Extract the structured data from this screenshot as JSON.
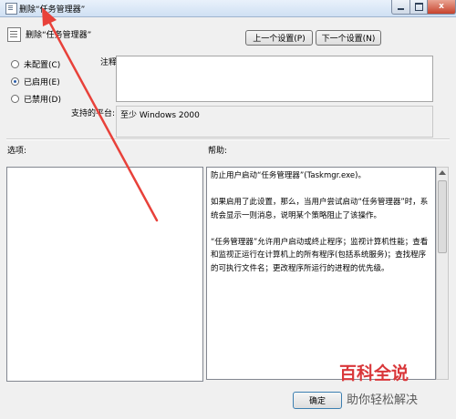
{
  "window": {
    "title": "删除“任务管理器”",
    "controls": {
      "close_label": "x"
    }
  },
  "header": {
    "title": "删除“任务管理器”",
    "prev_button": "上一个设置(P)",
    "next_button": "下一个设置(N)"
  },
  "state_options": [
    {
      "label": "未配置(C)",
      "checked": false
    },
    {
      "label": "已启用(E)",
      "checked": true
    },
    {
      "label": "已禁用(D)",
      "checked": false
    }
  ],
  "comment": {
    "label": "注释:",
    "value": ""
  },
  "platform": {
    "label": "支持的平台:",
    "value": "至少 Windows 2000"
  },
  "options": {
    "label": "选项:"
  },
  "help": {
    "label": "帮助:",
    "paragraphs": [
      "防止用户启动“任务管理器”(Taskmgr.exe)。",
      "如果启用了此设置，那么，当用户尝试启动“任务管理器”时，系统会显示一则消息，说明某个策略阻止了该操作。",
      "“任务管理器”允许用户启动或终止程序；监视计算机性能；查看和监视正运行在计算机上的所有程序(包括系统服务)；查找程序的可执行文件名；更改程序所运行的进程的优先级。"
    ]
  },
  "footer": {
    "ok_button": "确定"
  },
  "watermark": {
    "main": "百科全说",
    "sub": "助你轻松解决"
  },
  "colors": {
    "annotation_arrow": "#e8413a",
    "watermark_red": "#d9373a"
  }
}
